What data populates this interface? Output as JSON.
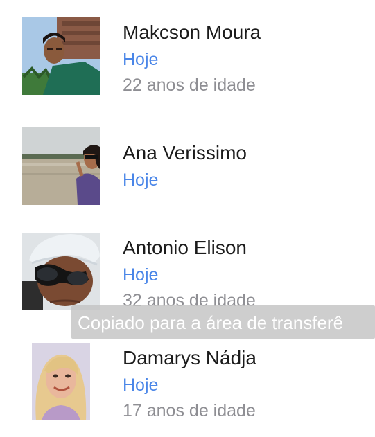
{
  "contacts": [
    {
      "name": "Makcson Moura",
      "when": "Hoje",
      "age": "22 anos de idade"
    },
    {
      "name": "Ana Verissimo",
      "when": "Hoje",
      "age": ""
    },
    {
      "name": "Antonio Elison",
      "when": "Hoje",
      "age": "32 anos de idade"
    },
    {
      "name": "Damarys Nádja",
      "when": "Hoje",
      "age": "17 anos de idade"
    }
  ],
  "toast": {
    "text": "Copiado para a área de transferê"
  },
  "colors": {
    "accent": "#4a86e8",
    "name_text": "#1b1b1b",
    "secondary_text": "#8e8e93",
    "toast_bg": "#c3c3c3"
  }
}
